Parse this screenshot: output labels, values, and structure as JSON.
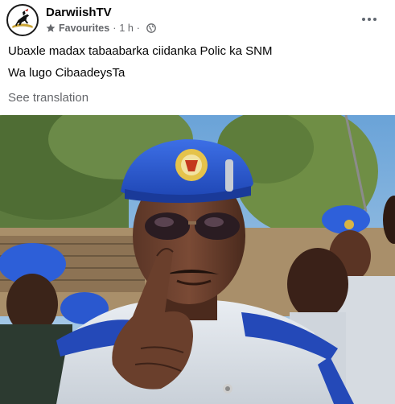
{
  "post": {
    "page_name": "DarwiishTV",
    "audience": "Favourites",
    "separator": "·",
    "time": "1 h",
    "text_lines": [
      "Ubaxle madax tabaabarka ciidanka Polic ka SNM",
      "Wa lugo CibaadeysTa"
    ],
    "see_translation": "See translation"
  },
  "icons": {
    "favourite": "star-icon",
    "audience": "globe-icon",
    "more": "more-options-icon"
  },
  "colors": {
    "secondary_text": "#65676b",
    "beret_blue": "#2c5bd6"
  }
}
